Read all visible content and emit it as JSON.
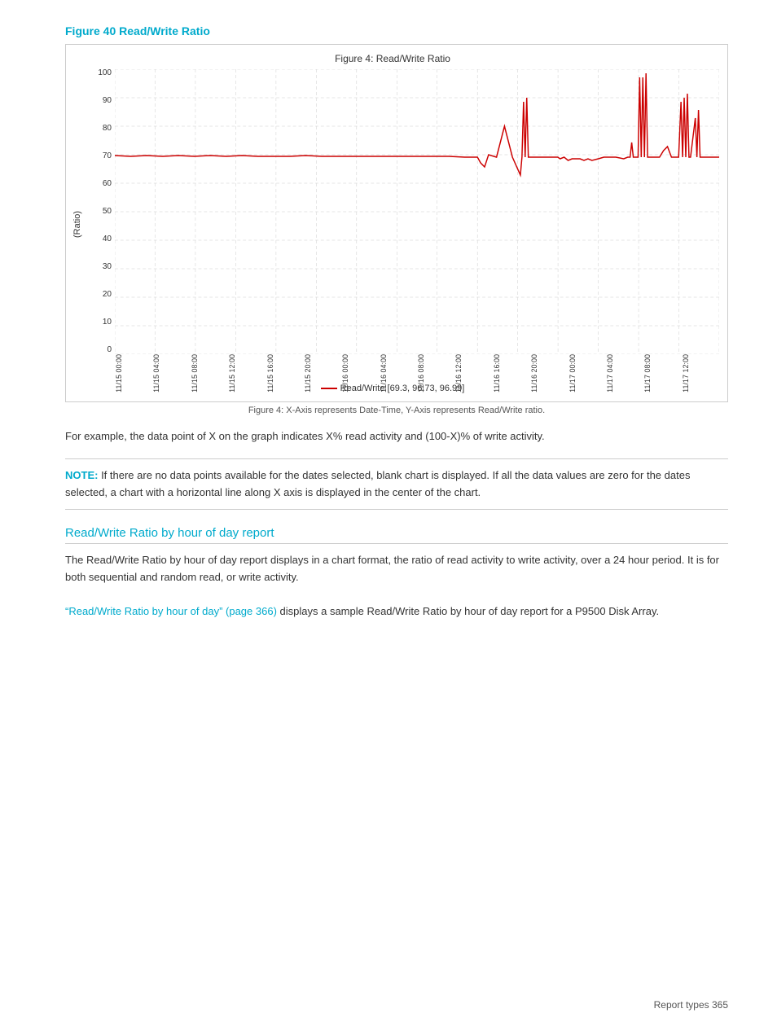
{
  "figure_heading": "Figure 40 Read/Write Ratio",
  "chart": {
    "title": "Figure 4: Read/Write Ratio",
    "y_axis_label": "(Ratio)",
    "y_ticks": [
      "0",
      "10",
      "20",
      "30",
      "40",
      "50",
      "60",
      "70",
      "80",
      "90",
      "100"
    ],
    "x_labels": [
      "11/15 00:00",
      "11/15 04:00",
      "11/15 08:00",
      "11/15 12:00",
      "11/15 16:00",
      "11/15 20:00",
      "11/16 00:00",
      "11/16 04:00",
      "11/16 08:00",
      "11/16 12:00",
      "11/16 16:00",
      "11/16 20:00",
      "11/17 00:00",
      "11/17 04:00",
      "11/17 08:00",
      "11/17 12:00"
    ],
    "legend_label": "Read/Write  [69.3, 96.73, 96.99]",
    "caption": "Figure 4: X-Axis represents Date-Time, Y-Axis represents Read/Write ratio."
  },
  "body_text": "For example, the data point of X on the graph indicates X% read activity and (100-X)% of write activity.",
  "note": {
    "label": "NOTE:",
    "text": "  If there are no data points available for the dates selected, blank chart is displayed. If all the data values are zero for the dates selected, a chart with a horizontal line along X axis is displayed in the center of the chart."
  },
  "section": {
    "heading": "Read/Write Ratio by hour of day report",
    "text1": "The Read/Write Ratio by hour of day report displays in a chart format, the ratio of read activity to write activity, over a 24 hour period. It is for both sequential and random read, or write activity.",
    "link_text": "“Read/Write Ratio by hour of day” (page 366)",
    "text2": " displays a sample Read/Write Ratio by hour of day report for a P9500 Disk Array."
  },
  "footer": {
    "text": "Report types   365"
  }
}
